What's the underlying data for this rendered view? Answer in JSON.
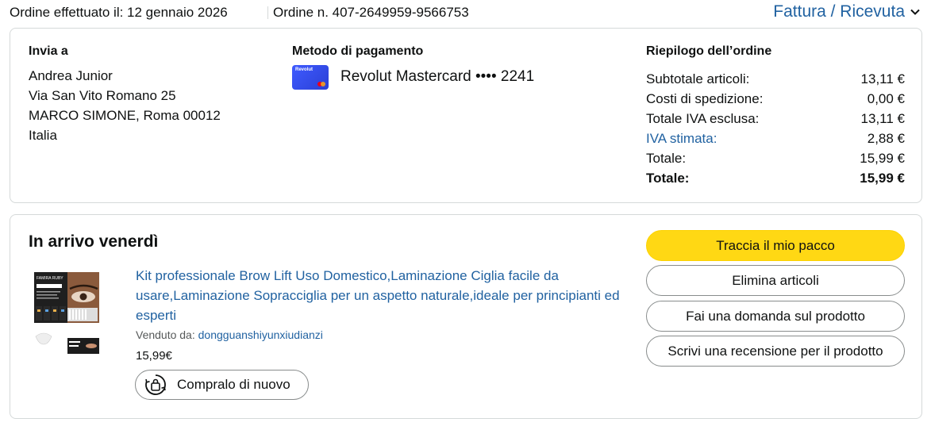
{
  "header": {
    "order_date": "Ordine effettuato il: 12 gennaio 2026",
    "order_number": "Ordine n. 407-2649959-9566753",
    "invoice_link": "Fattura / Ricevuta"
  },
  "shipping": {
    "title": "Invia a",
    "lines": [
      "Andrea Junior",
      "Via San Vito Romano 25",
      "MARCO SIMONE, Roma 00012",
      "Italia"
    ]
  },
  "payment": {
    "title": "Metodo di pagamento",
    "card_icon": "revolut-mastercard-icon",
    "card_brand_text": "Revolut",
    "method": "Revolut Mastercard •••• 2241"
  },
  "summary": {
    "title": "Riepilogo dell’ordine",
    "rows": [
      {
        "label": "Subtotale articoli:",
        "value": "13,11 €"
      },
      {
        "label": "Costi di spedizione:",
        "value": "0,00 €"
      },
      {
        "label": "Totale IVA esclusa:",
        "value": "13,11 €"
      },
      {
        "label": "IVA stimata:",
        "value": "2,88 €"
      },
      {
        "label": "Totale:",
        "value": "15,99 €"
      },
      {
        "label": "Totale:",
        "value": "15,99 €"
      }
    ]
  },
  "shipment": {
    "title": "In arrivo venerdì",
    "product": {
      "title": "Kit professionale Brow Lift Uso Domestico,Laminazione Ciglia facile da usare,Laminazione Sopracciglia per un aspetto naturale,ideale per principianti ed esperti",
      "sold_by_label": "Venduto da:",
      "seller": "dongguanshiyunxiudianzi",
      "price": "15,99€",
      "image_brand_text": "FAMIRA RUBY",
      "rebuy_label": "Compralo di nuovo",
      "rebuy_icon": "buy-again-icon"
    },
    "actions": [
      "Traccia il mio pacco",
      "Elimina articoli",
      "Fai una domanda sul prodotto",
      "Scrivi una recensione per il prodotto"
    ]
  },
  "colors": {
    "link": "#2162a1",
    "primary_button": "#ffd814",
    "border": "#d5d9d9",
    "text": "#0f1111"
  }
}
